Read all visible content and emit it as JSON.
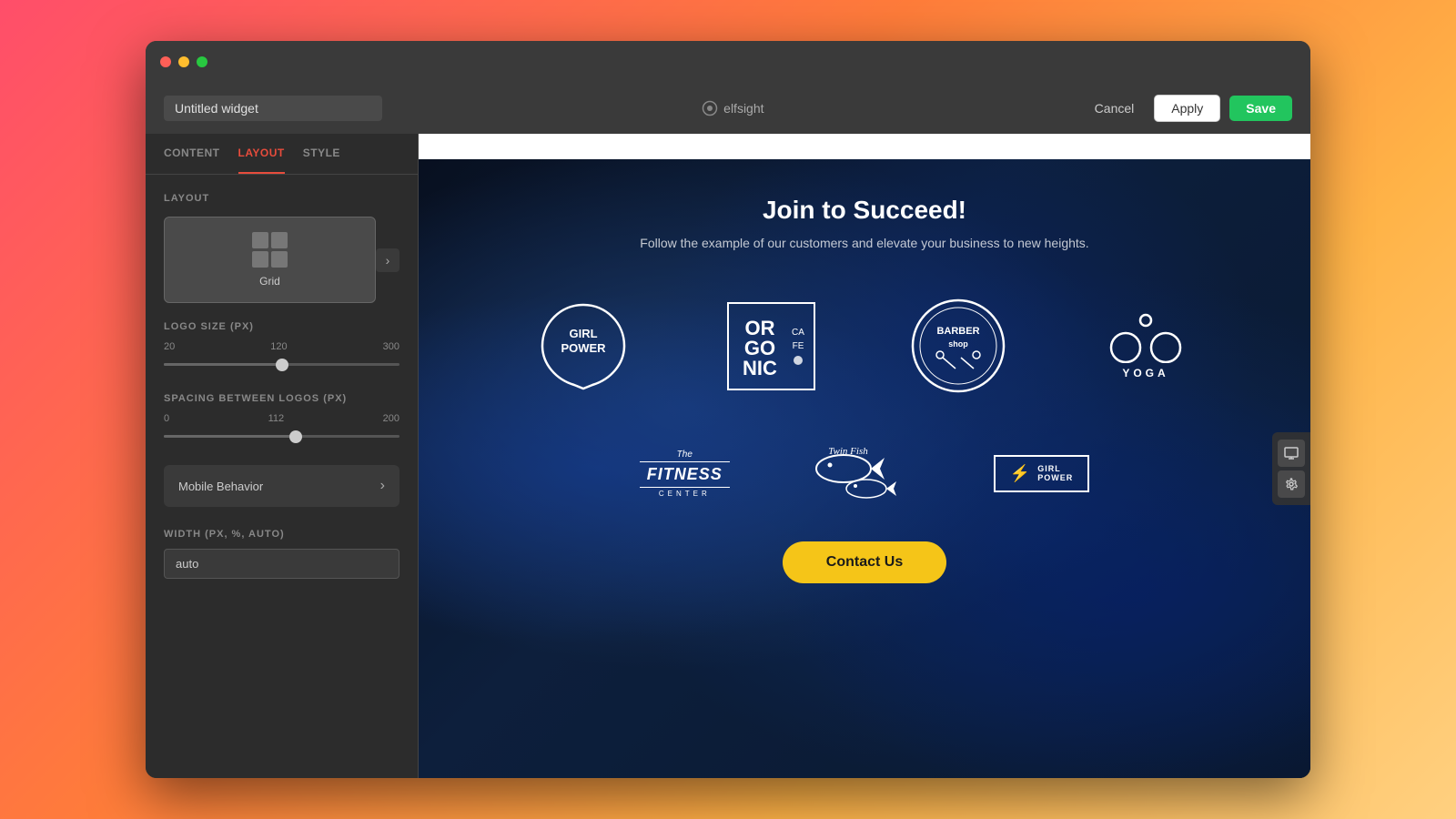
{
  "browser": {
    "traffic_lights": [
      "red",
      "yellow",
      "green"
    ]
  },
  "header": {
    "widget_title": "Untitled widget",
    "widget_title_placeholder": "Untitled widget",
    "logo_text": "elfsight",
    "cancel_label": "Cancel",
    "apply_label": "Apply",
    "save_label": "Save"
  },
  "sidebar": {
    "tabs": [
      {
        "id": "content",
        "label": "CONTENT",
        "active": false
      },
      {
        "id": "layout",
        "label": "LAYOUT",
        "active": true
      },
      {
        "id": "style",
        "label": "STYLE",
        "active": false
      }
    ],
    "layout_section_label": "LAYOUT",
    "layout_options": [
      {
        "id": "grid",
        "label": "Grid",
        "active": true
      }
    ],
    "logo_size_label": "LOGO SIZE (PX)",
    "logo_size_min": "20",
    "logo_size_mid": "120",
    "logo_size_max": "300",
    "logo_size_value": 120,
    "logo_size_percent": 50,
    "spacing_label": "SPACING BETWEEN LOGOS (PX)",
    "spacing_min": "0",
    "spacing_mid": "112",
    "spacing_max": "200",
    "spacing_value": 112,
    "spacing_percent": 56,
    "mobile_behavior_label": "Mobile Behavior",
    "width_label": "WIDTH (PX, %, AUTO)",
    "width_value": "auto"
  },
  "preview": {
    "heading": "Join to Succeed!",
    "subheading": "Follow the example of our customers and elevate your business to new heights.",
    "logos": [
      {
        "id": "girlpower",
        "alt": "Girl Power"
      },
      {
        "id": "organic",
        "alt": "Organic Cafe"
      },
      {
        "id": "barbershop",
        "alt": "Barber Shop"
      },
      {
        "id": "yoga",
        "alt": "Yoga"
      },
      {
        "id": "fitness",
        "alt": "The Fitness Center"
      },
      {
        "id": "twinfish",
        "alt": "Twin Fish"
      },
      {
        "id": "girlpower2",
        "alt": "Girl Power 2"
      }
    ],
    "contact_btn": "Contact Us"
  },
  "toolbar": {
    "device_icon": "🖥",
    "settings_icon": "⚙"
  }
}
